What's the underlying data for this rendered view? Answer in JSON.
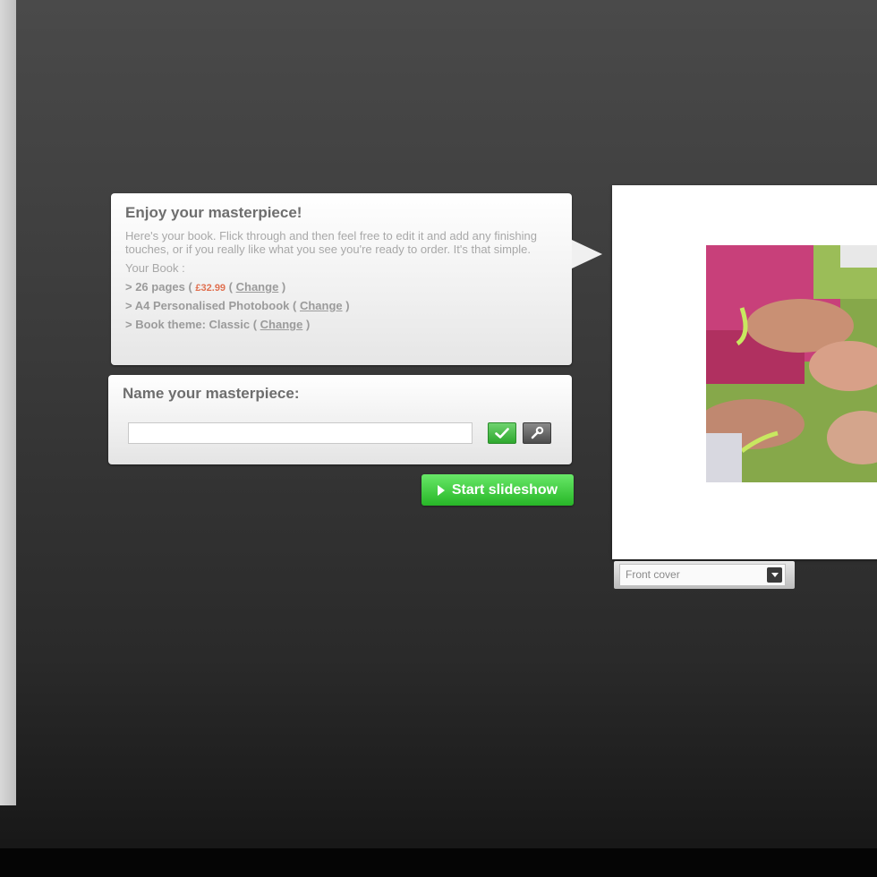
{
  "info_panel": {
    "title": "Enjoy your masterpiece!",
    "description": "Here's your book. Flick through and then feel free to edit it and add any finishing touches, or if you really like what you see you're ready to order. It's that simple.",
    "your_book_label": "Your Book :",
    "pages_text": "> 26 pages (",
    "price": "£32.99",
    "pages_sep": "(",
    "change_label": "Change",
    "close_paren": ")",
    "format_text": "> A4 Personalised Photobook (",
    "theme_text": "> Book theme: Classic ("
  },
  "name_panel": {
    "title": "Name your masterpiece:",
    "input_value": "",
    "input_placeholder": ""
  },
  "slideshow_button": {
    "label": "Start slideshow"
  },
  "preview": {
    "page_select": {
      "selected": "Front cover"
    }
  },
  "colors": {
    "accent_green": "#2ea82e",
    "price_color": "#e07050"
  },
  "icons": {
    "confirm": "check-icon",
    "tools": "wrench-icon",
    "play": "play-icon",
    "dropdown": "chevron-down-icon"
  }
}
